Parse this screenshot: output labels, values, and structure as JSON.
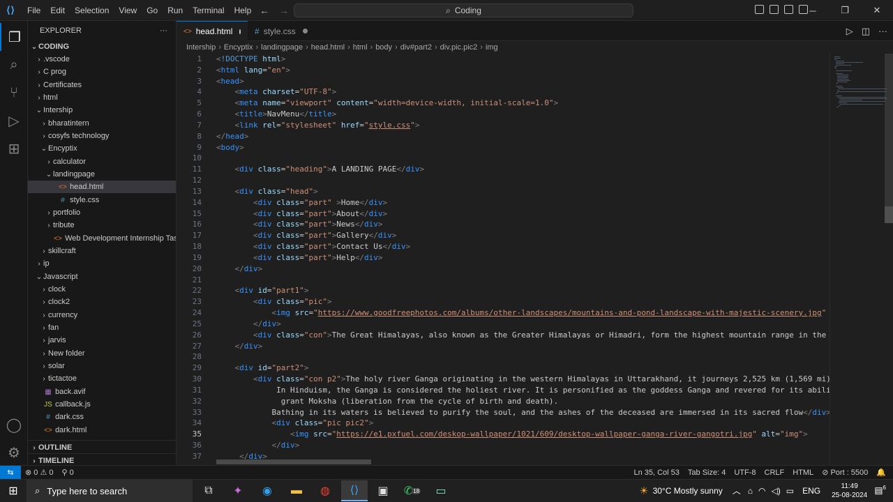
{
  "menu": [
    "File",
    "Edit",
    "Selection",
    "View",
    "Go",
    "Run",
    "Terminal",
    "Help"
  ],
  "search_text": "Coding",
  "explorer": {
    "title": "EXPLORER",
    "root": "CODING",
    "items": [
      {
        "label": ".vscode",
        "type": "folder",
        "open": false,
        "indent": 1
      },
      {
        "label": "C prog",
        "type": "folder",
        "open": false,
        "indent": 1
      },
      {
        "label": "Certificates",
        "type": "folder",
        "open": false,
        "indent": 1
      },
      {
        "label": "html",
        "type": "folder",
        "open": false,
        "indent": 1
      },
      {
        "label": "Intership",
        "type": "folder",
        "open": true,
        "indent": 1
      },
      {
        "label": "bharatintern",
        "type": "folder",
        "open": false,
        "indent": 2
      },
      {
        "label": "cosyfs technology",
        "type": "folder",
        "open": false,
        "indent": 2
      },
      {
        "label": "Encyptix",
        "type": "folder",
        "open": true,
        "indent": 2
      },
      {
        "label": "calculator",
        "type": "folder",
        "open": false,
        "indent": 3
      },
      {
        "label": "landingpage",
        "type": "folder",
        "open": true,
        "indent": 3
      },
      {
        "label": "head.html",
        "type": "html",
        "indent": 4,
        "selected": true
      },
      {
        "label": "style.css",
        "type": "css",
        "indent": 4
      },
      {
        "label": "portfolio",
        "type": "folder",
        "open": false,
        "indent": 3
      },
      {
        "label": "tribute",
        "type": "folder",
        "open": false,
        "indent": 3
      },
      {
        "label": "Web Development Internship Task...",
        "type": "html",
        "indent": 3
      },
      {
        "label": "skillcraft",
        "type": "folder",
        "open": false,
        "indent": 2
      },
      {
        "label": "ip",
        "type": "folder",
        "open": false,
        "indent": 1
      },
      {
        "label": "Javascript",
        "type": "folder",
        "open": true,
        "indent": 1
      },
      {
        "label": "clock",
        "type": "folder",
        "open": false,
        "indent": 2
      },
      {
        "label": "clock2",
        "type": "folder",
        "open": false,
        "indent": 2
      },
      {
        "label": "currency",
        "type": "folder",
        "open": false,
        "indent": 2
      },
      {
        "label": "fan",
        "type": "folder",
        "open": false,
        "indent": 2
      },
      {
        "label": "jarvis",
        "type": "folder",
        "open": false,
        "indent": 2
      },
      {
        "label": "New folder",
        "type": "folder",
        "open": false,
        "indent": 2
      },
      {
        "label": "solar",
        "type": "folder",
        "open": false,
        "indent": 2
      },
      {
        "label": "tictactoe",
        "type": "folder",
        "open": false,
        "indent": 2
      },
      {
        "label": "back.avif",
        "type": "image",
        "indent": 1
      },
      {
        "label": "callback.js",
        "type": "js",
        "indent": 1
      },
      {
        "label": "dark.css",
        "type": "css",
        "indent": 1
      },
      {
        "label": "dark.html",
        "type": "html",
        "indent": 1
      }
    ],
    "outline": "OUTLINE",
    "timeline": "TIMELINE"
  },
  "tabs": [
    {
      "label": "head.html",
      "active": true,
      "modified": true
    },
    {
      "label": "style.css",
      "active": false,
      "modified": true
    }
  ],
  "breadcrumb": [
    "Intership",
    "Encyptix",
    "landingpage",
    "head.html",
    "html",
    "body",
    "div#part2",
    "div.pic.pic2",
    "img"
  ],
  "code_lines": [
    "<!DOCTYPE html>",
    "<html lang=\"en\">",
    "<head>",
    "    <meta charset=\"UTF-8\">",
    "    <meta name=\"viewport\" content=\"width=device-width, initial-scale=1.0\">",
    "    <title>NavMenu</title>",
    "    <link rel=\"stylesheet\" href=\"style.css\">",
    "</head>",
    "<body>",
    "",
    "    <div class=\"heading\">A LANDING PAGE</div>",
    "",
    "    <div class=\"head\">",
    "        <div class=\"part\" >Home</div>",
    "        <div class=\"part\">About</div>",
    "        <div class=\"part\">News</div>",
    "        <div class=\"part\">Gallery</div>",
    "        <div class=\"part\">Contact Us</div>",
    "        <div class=\"part\">Help</div>",
    "    </div>",
    "",
    "    <div id=\"part1\">",
    "        <div class=\"pic\">",
    "            <img src=\"https://www.goodfreephotos.com/albums/other-landscapes/mountains-and-pond-landscape-with-majestic-scenery.jpg\" alt=",
    "        </div>",
    "        <div class=\"con\">The Great Himalayas, also known as the Greater Himalayas or Himadri, form the highest mountain range in the worl",
    "    </div>",
    "",
    "    <div id=\"part2\">",
    "        <div class=\"con p2\">The holy river Ganga originating in the western Himalayas in Uttarakhand, it journeys 2,525 km (1,569 mi) sou",
    "             In Hinduism, the Ganga is considered the holiest river. It is personified as the goddess Ganga and revered for its ability t",
    "              grant Moksha (liberation from the cycle of birth and death).",
    "            Bathing in its waters is believed to purify the soul, and the ashes of the deceased are immersed in its sacred flow</div>",
    "            <div class=\"pic pic2\">",
    "                <img src=\"https://e1.pxfuel.com/deskop-wallpaper/1021/609/desktop-wallpaper-ganga-river-gangotri.jpg\" alt=\"img\">",
    "            </div>",
    "     </div>"
  ],
  "current_line": 35,
  "status": {
    "errors": "0",
    "warnings": "0",
    "ports_count": "0",
    "position": "Ln 35, Col 53",
    "tab_size": "Tab Size: 4",
    "encoding": "UTF-8",
    "eol": "CRLF",
    "language": "HTML",
    "port": "Port : 5500"
  },
  "taskbar": {
    "search_placeholder": "Type here to search",
    "weather": "30°C  Mostly sunny",
    "lang": "ENG",
    "time": "11:49",
    "date": "25-08-2024",
    "notif_count": "6",
    "whatsapp_badge": "18"
  }
}
